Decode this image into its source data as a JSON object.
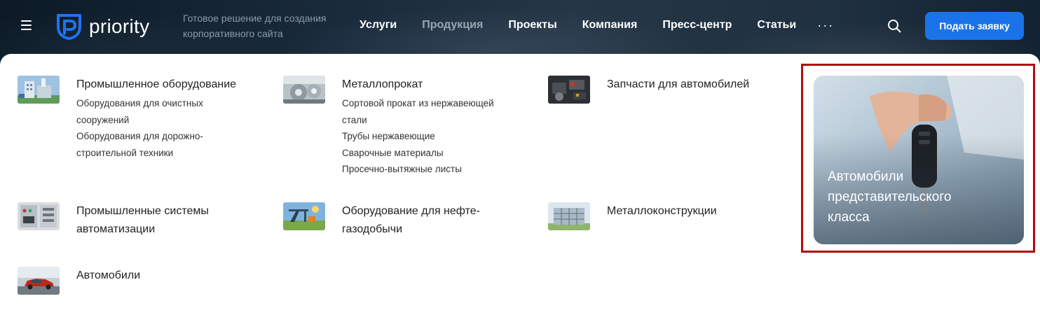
{
  "header": {
    "logo_text": "priority",
    "tagline": "Готовое решение для создания корпоративного сайта",
    "nav": [
      {
        "label": "Услуги",
        "active": false
      },
      {
        "label": "Продукция",
        "active": true
      },
      {
        "label": "Проекты",
        "active": false
      },
      {
        "label": "Компания",
        "active": false
      },
      {
        "label": "Пресс-центр",
        "active": false
      },
      {
        "label": "Статьи",
        "active": false
      }
    ],
    "more_label": "···",
    "cta_label": "Подать заявку",
    "accent_color": "#1a73e8"
  },
  "menu": {
    "categories": [
      {
        "title": "Промышленное оборудование",
        "icon": "industrial-building-photo",
        "subs": [
          "Оборудования для очистных сооружений",
          "Оборудования для дорожно-строительной техники"
        ]
      },
      {
        "title": "Металлопрокат",
        "icon": "metal-rolls-photo",
        "subs": [
          "Сортовой прокат из нержавеющей стали",
          "Трубы нержавеющие",
          "Сварочные материалы",
          "Просечно-вытяжные листы"
        ]
      },
      {
        "title": "Запчасти для автомобилей",
        "icon": "car-engine-photo",
        "subs": []
      },
      {
        "title": "Промышленные системы автоматизации",
        "icon": "control-panel-photo",
        "subs": []
      },
      {
        "title": "Оборудование для нефте-газодобычи",
        "icon": "oil-pump-photo",
        "subs": []
      },
      {
        "title": "Металлоконструкции",
        "icon": "steel-structure-photo",
        "subs": []
      },
      {
        "title": "Автомобили",
        "icon": "red-car-photo",
        "subs": []
      }
    ],
    "promo": {
      "title": "Автомобили представительского класса",
      "image": "hand-holding-car-key-photo"
    }
  }
}
